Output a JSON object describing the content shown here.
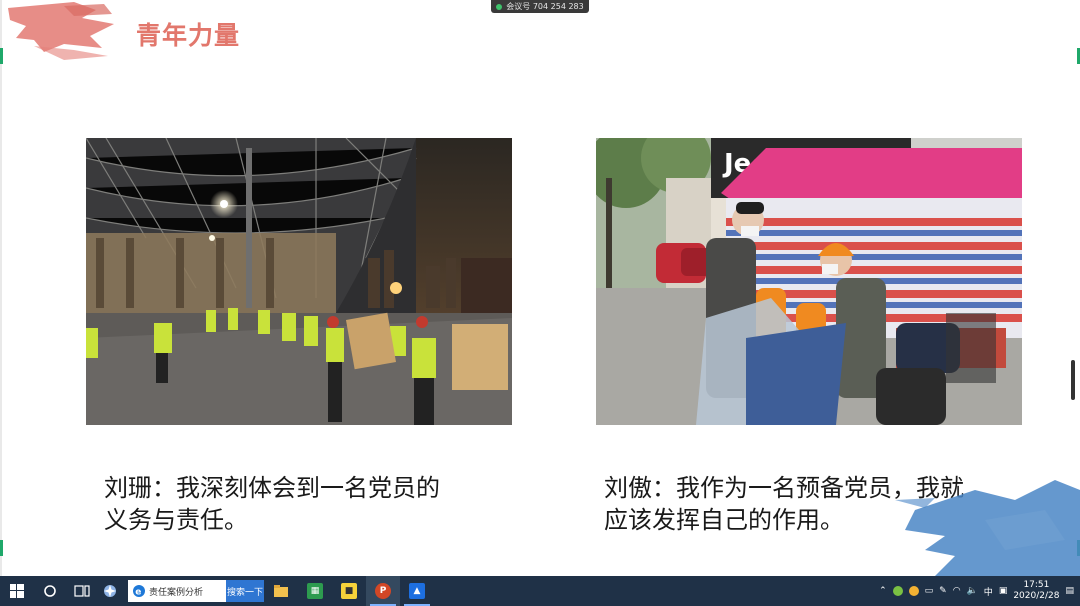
{
  "slide": {
    "title": "青年力量",
    "meeting_id": "会议号 704 254 283",
    "captions": [
      {
        "line1": "刘珊：我深刻体会到一名党员的",
        "line2": "义务与责任。"
      },
      {
        "line1": "刘傲：我作为一名预备党员，我就",
        "line2": "应该发挥自己的作用。"
      }
    ],
    "photo_left_alt": "volunteers-moving-boxes-at-night",
    "photo_right_alt": "volunteer-temperature-check-tent",
    "store_sign": "Jeep"
  },
  "taskbar": {
    "search_text": "责任案例分析",
    "search_button": "搜索一下",
    "time": "17:51",
    "date": "2020/2/28",
    "ime_label": "中",
    "icons": [
      "windows-start-icon",
      "cortana-icon",
      "task-view-icon",
      "pinwheel-icon",
      "edge-icon",
      "file-explorer-icon",
      "green-app-icon",
      "sticky-notes-icon",
      "powerpoint-icon",
      "meeting-app-icon"
    ]
  },
  "colors": {
    "title": "#e2776c",
    "taskbar": "#1f3147",
    "accent_blue": "#2f76d2"
  }
}
